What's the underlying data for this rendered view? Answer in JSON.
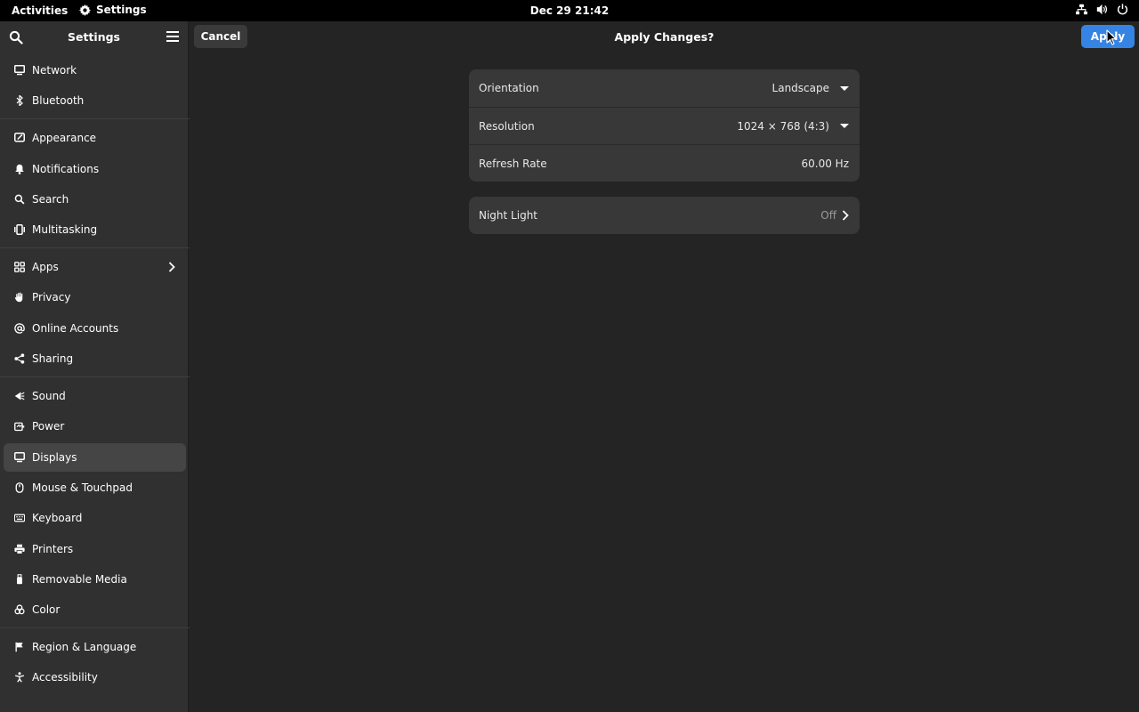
{
  "topbar": {
    "activities": "Activities",
    "app_name": "Settings",
    "clock": "Dec 29  21:42"
  },
  "sidebar": {
    "title": "Settings",
    "groups": [
      [
        {
          "label": "Network",
          "icon": "network-icon"
        },
        {
          "label": "Bluetooth",
          "icon": "bluetooth-icon"
        }
      ],
      [
        {
          "label": "Appearance",
          "icon": "appearance-icon"
        },
        {
          "label": "Notifications",
          "icon": "bell-icon"
        },
        {
          "label": "Search",
          "icon": "search-icon"
        },
        {
          "label": "Multitasking",
          "icon": "multitasking-icon"
        }
      ],
      [
        {
          "label": "Apps",
          "icon": "apps-icon",
          "has_submenu": true
        },
        {
          "label": "Privacy",
          "icon": "hand-icon"
        },
        {
          "label": "Online Accounts",
          "icon": "at-icon"
        },
        {
          "label": "Sharing",
          "icon": "share-icon"
        }
      ],
      [
        {
          "label": "Sound",
          "icon": "speaker-icon"
        },
        {
          "label": "Power",
          "icon": "power-battery-icon"
        },
        {
          "label": "Displays",
          "icon": "display-icon",
          "active": true
        },
        {
          "label": "Mouse & Touchpad",
          "icon": "mouse-icon"
        },
        {
          "label": "Keyboard",
          "icon": "keyboard-icon"
        },
        {
          "label": "Printers",
          "icon": "printer-icon"
        },
        {
          "label": "Removable Media",
          "icon": "usb-icon"
        },
        {
          "label": "Color",
          "icon": "color-icon"
        }
      ],
      [
        {
          "label": "Region & Language",
          "icon": "flag-icon"
        },
        {
          "label": "Accessibility",
          "icon": "accessibility-icon"
        }
      ]
    ]
  },
  "header": {
    "cancel_label": "Cancel",
    "title": "Apply Changes?",
    "apply_label": "Apply"
  },
  "display_settings": {
    "orientation": {
      "label": "Orientation",
      "value": "Landscape"
    },
    "resolution": {
      "label": "Resolution",
      "value": "1024 × 768 (4:3)"
    },
    "refresh_rate": {
      "label": "Refresh Rate",
      "value": "60.00 Hz"
    }
  },
  "night_light": {
    "label": "Night Light",
    "value": "Off"
  },
  "colors": {
    "accent": "#3584e4",
    "window_bg": "#242424",
    "sidebar_bg": "#303030",
    "card_bg": "#383838"
  }
}
